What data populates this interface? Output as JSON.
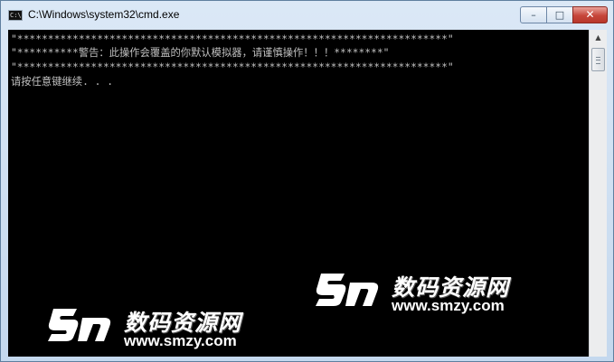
{
  "window": {
    "title": "C:\\Windows\\system32\\cmd.exe",
    "icon_label": "C:\\",
    "buttons": {
      "minimize": "–",
      "maximize": "□",
      "close": "✕"
    }
  },
  "console": {
    "lines": [
      "\"**********************************************************************\"",
      "\"**********警告：此操作会覆盖的你默认模拟器，请谨慎操作！！！********\"",
      "\"**********************************************************************\"",
      "请按任意键继续. . ."
    ],
    "text_color": "#c0c0c0",
    "background": "#000000"
  },
  "watermark": {
    "brand": "数码资源网",
    "url": "www.smzy.com"
  }
}
